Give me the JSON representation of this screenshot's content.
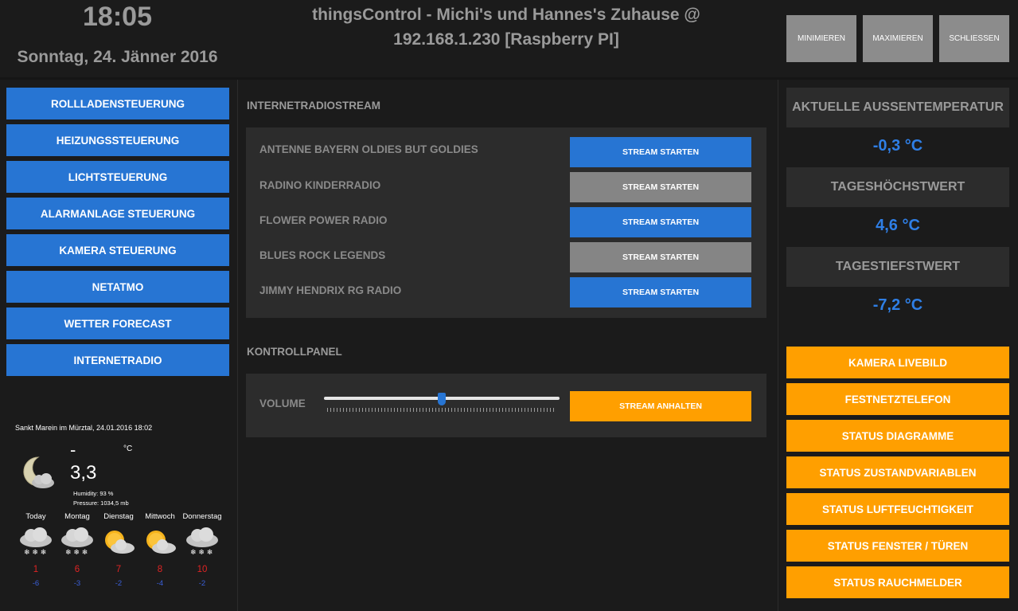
{
  "header": {
    "time": "18:05",
    "date": "Sonntag, 24. Jänner 2016",
    "title_line1": "thingsControl - Michi's und Hannes's Zuhause @",
    "title_line2": "192.168.1.230 [Raspberry PI]",
    "buttons": {
      "minimize": "MINIMIEREN",
      "maximize": "MAXIMIEREN",
      "close": "SCHLIESSEN"
    }
  },
  "sidebar": {
    "items": [
      {
        "label": "ROLLLADENSTEUERUNG"
      },
      {
        "label": "HEIZUNGSSTEUERUNG"
      },
      {
        "label": "LICHTSTEUERUNG"
      },
      {
        "label": "ALARMANLAGE STEUERUNG"
      },
      {
        "label": "KAMERA STEUERUNG"
      },
      {
        "label": "NETATMO"
      },
      {
        "label": "WETTER FORECAST"
      },
      {
        "label": "INTERNETRADIO"
      }
    ]
  },
  "weather": {
    "location_time": "Sankt Marein im Mürztal, 24.01.2016 18:02",
    "unit": "°C",
    "dash": "-",
    "temperature": "3,3",
    "humidity": "Humidity:  93 %",
    "pressure": "Pressure:  1034,5 mb",
    "forecast": [
      {
        "day": "Today",
        "high": "1",
        "low": "-6",
        "icon": "snow-cloud-icon"
      },
      {
        "day": "Montag",
        "high": "6",
        "low": "-3",
        "icon": "snow-cloud-icon"
      },
      {
        "day": "Dienstag",
        "high": "7",
        "low": "-2",
        "icon": "partly-cloudy-icon"
      },
      {
        "day": "Mittwoch",
        "high": "8",
        "low": "-4",
        "icon": "partly-cloudy-icon"
      },
      {
        "day": "Donnerstag",
        "high": "10",
        "low": "-2",
        "icon": "snow-cloud-icon"
      }
    ]
  },
  "radio": {
    "section_title": "INTERNETRADIOSTREAM",
    "stations": [
      {
        "name": "ANTENNE BAYERN OLDIES BUT GOLDIES",
        "button": "STREAM STARTEN",
        "color": "#2775d3"
      },
      {
        "name": "RADINO KINDERRADIO",
        "button": "STREAM STARTEN",
        "color": "#858585"
      },
      {
        "name": "FLOWER POWER RADIO",
        "button": "STREAM STARTEN",
        "color": "#2775d3"
      },
      {
        "name": "BLUES ROCK LEGENDS",
        "button": "STREAM STARTEN",
        "color": "#858585"
      },
      {
        "name": "JIMMY HENDRIX RG RADIO",
        "button": "STREAM STARTEN",
        "color": "#2775d3"
      }
    ]
  },
  "control": {
    "section_title": "KONTROLLPANEL",
    "volume_label": "VOLUME",
    "volume_fraction": 0.5,
    "stop_button": "STREAM ANHALTEN"
  },
  "temps": {
    "outside_label": "AKTUELLE AUSSENTEMPERATUR",
    "outside_value": "-0,3 °C",
    "max_label": "TAGESHÖCHSTWERT",
    "max_value": "4,6 °C",
    "min_label": "TAGESTIEFSTWERT",
    "min_value": "-7,2 °C"
  },
  "actions": [
    {
      "label": "KAMERA LIVEBILD"
    },
    {
      "label": "FESTNETZTELEFON"
    },
    {
      "label": "STATUS DIAGRAMME"
    },
    {
      "label": "STATUS ZUSTANDVARIABLEN"
    },
    {
      "label": "STATUS LUFTFEUCHTIGKEIT"
    },
    {
      "label": "STATUS FENSTER / TÜREN"
    },
    {
      "label": "STATUS RAUCHMELDER"
    }
  ],
  "colors": {
    "accent_blue": "#2775d3",
    "accent_orange": "#ff9f00",
    "inactive_gray": "#858585",
    "value_blue": "#2f7fe6",
    "background": "#1b1b1b"
  }
}
